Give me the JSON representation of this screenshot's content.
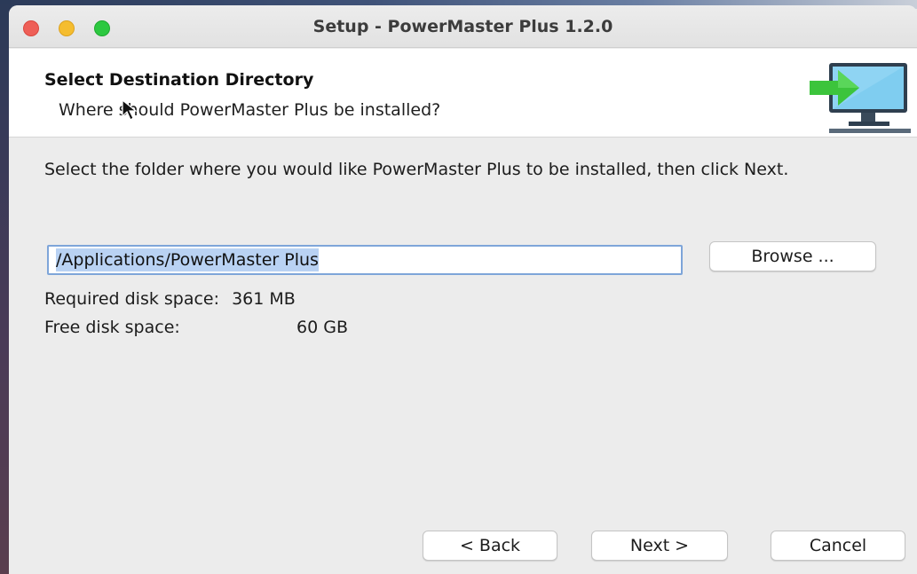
{
  "window": {
    "title": "Setup - PowerMaster Plus 1.2.0"
  },
  "header": {
    "title": "Select Destination Directory",
    "subtitle": "Where should PowerMaster Plus be installed?",
    "icon": "install-computer-arrow-icon"
  },
  "main": {
    "instructions": "Select the folder where you would like PowerMaster Plus to be installed, then click Next.",
    "path_value": "/Applications/PowerMaster Plus",
    "browse_label": "Browse ...",
    "required_label": "Required disk space:",
    "required_value": "361 MB",
    "free_label": "Free disk space:",
    "free_value": "60 GB"
  },
  "footer": {
    "back_label": "< Back",
    "next_label": "Next >",
    "cancel_label": "Cancel"
  },
  "colors": {
    "close": "#ee5f57",
    "minimize": "#f5bd2f",
    "maximize": "#2cc840",
    "selection": "#b9d2f3",
    "focus_ring": "#7ea5d9",
    "icon_green": "#3cc43c",
    "icon_blue": "#6fc3ec"
  }
}
